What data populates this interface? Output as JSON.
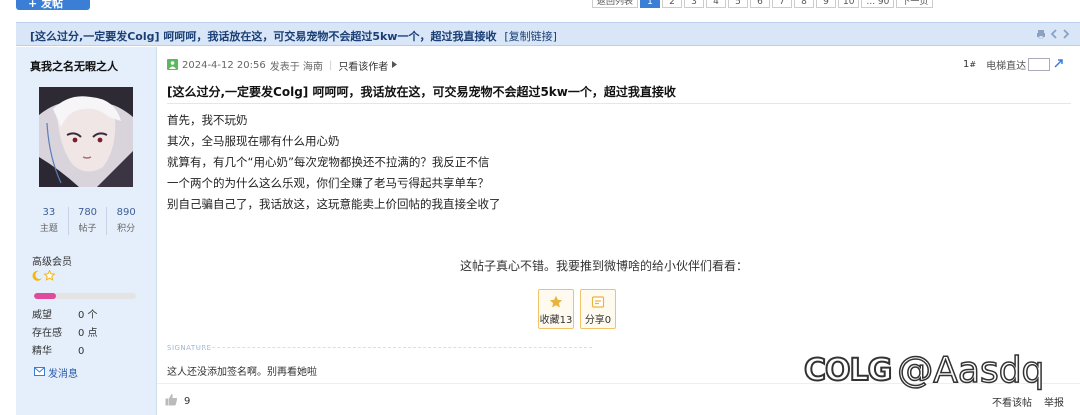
{
  "pager": {
    "items": [
      "返回列表",
      "1",
      "2",
      "3",
      "4",
      "5",
      "6",
      "7",
      "8",
      "9",
      "10",
      "... 90",
      "下一页"
    ],
    "active_index": 1
  },
  "thread": {
    "title": "[这么过分,一定要发Colg] 呵呵呵，我话放在这，可交易宠物不会超过5kw一个，超过我直接收",
    "copy_link": "[复制链接]"
  },
  "author": {
    "name": "真我之名无暇之人",
    "stats": [
      {
        "num": "33",
        "label": "主题"
      },
      {
        "num": "780",
        "label": "帖子"
      },
      {
        "num": "890",
        "label": "积分"
      }
    ],
    "rank": "高级会员",
    "rank_progress": 0.22,
    "attrs": [
      {
        "key": "威望",
        "value": "0 个"
      },
      {
        "key": "存在感",
        "value": "0 点"
      },
      {
        "key": "精华",
        "value": "0"
      }
    ],
    "send_message": "发消息"
  },
  "post": {
    "date": "2024-4-12 20:56",
    "posted_in": "发表于 海南",
    "only_author": "只看该作者",
    "floor_num": "1",
    "floor_sym": "#",
    "jump_label": "电梯直达",
    "title": "[这么过分,一定要发Colg] 呵呵呵，我话放在这，可交易宠物不会超过5kw一个，超过我直接收",
    "body": [
      "首先，我不玩奶",
      "其次，全马服现在哪有什么用心奶",
      "就算有，有几个“用心奶”每次宠物都换还不拉满的？我反正不信",
      "一个两个的为什么这么乐观，你们全赚了老马亏得起共享单车？",
      "别自己骗自己了，我话放这，这玩意能卖上价回帖的我直接全收了"
    ],
    "share_prompt": "这帖子真心不错。我要推到微博啥的给小伙伴们看看：",
    "favorite_label": "收藏13",
    "share_label": "分享0",
    "signature_label": "SIGNATURE",
    "signature_text": "这人还没添加签名啊。别再看她啦",
    "likes": "9",
    "not_interested": "不看该帖",
    "report": "举报"
  },
  "watermark": {
    "logo": "COLG",
    "handle": "@Aasdq"
  },
  "colors": {
    "accent": "#3b7ed6",
    "title_bar": "#d8e6f8",
    "author_bg": "#e5effb",
    "rank_bar": "#e04a9a",
    "action_border": "#f0c36b"
  }
}
